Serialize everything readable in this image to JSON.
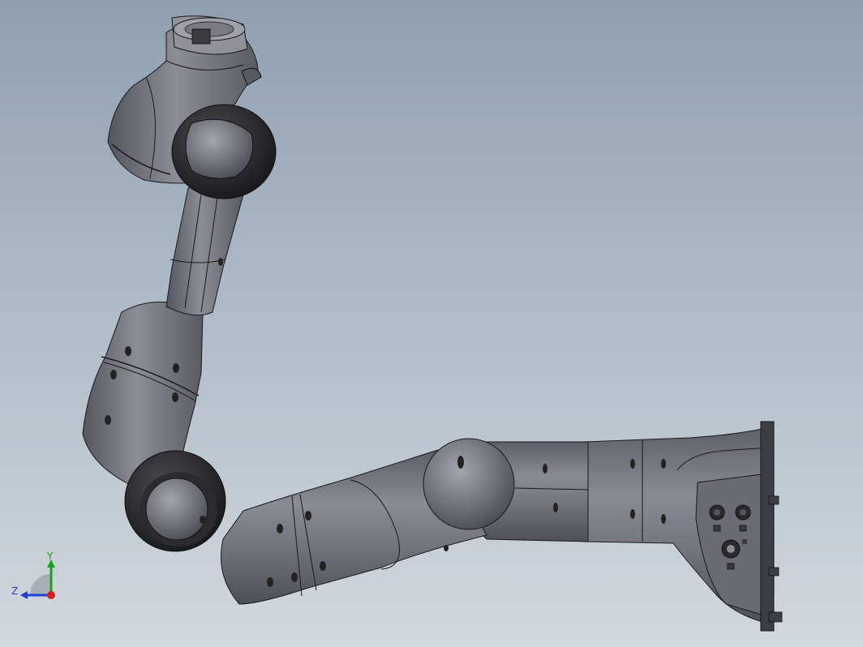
{
  "viewport": {
    "background_top": "#8f9fb2",
    "background_bottom": "#d2d8dd"
  },
  "model": {
    "body_color": "#6f7077",
    "dark_ring_color": "#1f1f22",
    "edge_color": "#1a1a1a"
  },
  "triad": {
    "y_label": "Y",
    "z_label": "Z",
    "y_color": "#1aa31a",
    "z_color": "#1f3fd8",
    "x_color": "#d42020"
  }
}
